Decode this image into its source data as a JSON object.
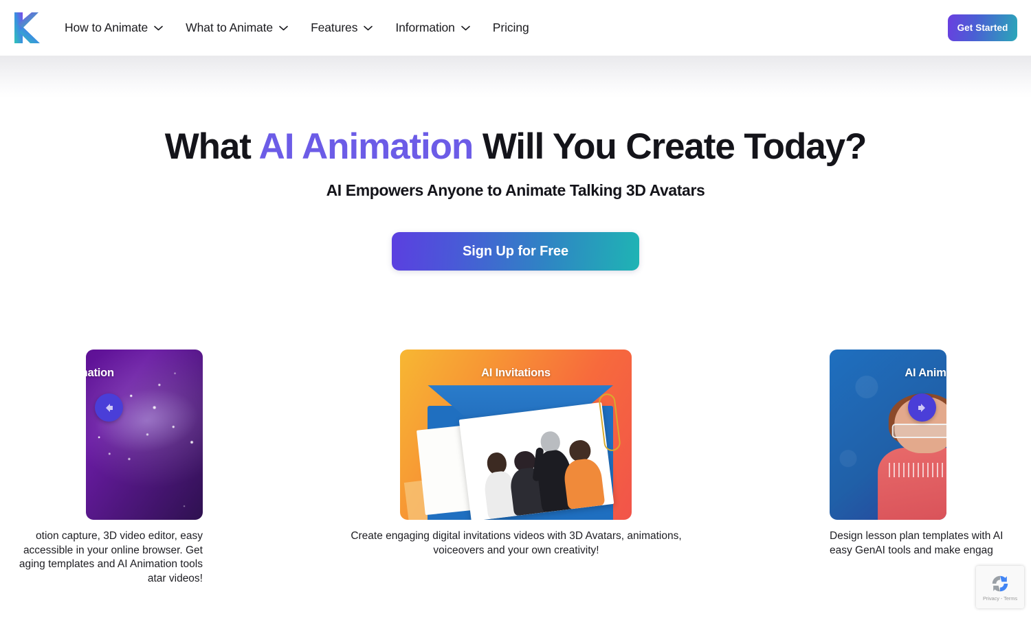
{
  "header": {
    "logo_alt": "Kinetix logo",
    "nav_items": [
      {
        "label": "How to Animate",
        "has_dropdown": true
      },
      {
        "label": "What to Animate",
        "has_dropdown": true
      },
      {
        "label": "Features",
        "has_dropdown": true
      },
      {
        "label": "Information",
        "has_dropdown": true
      },
      {
        "label": "Pricing",
        "has_dropdown": false
      }
    ],
    "get_started_label": "Get Started"
  },
  "hero": {
    "title_part1": "What ",
    "title_accent": "AI Animation",
    "title_part2": " Will You Create Today?",
    "subtitle": "AI Empowers Anyone to Animate Talking 3D Avatars",
    "cta_label": "Sign Up for Free"
  },
  "carousel": {
    "prev_icon": "arrow-left-icon",
    "next_icon": "arrow-right-icon",
    "slides": [
      {
        "id": "magic",
        "title": "Animation",
        "caption_lines": [
          "otion capture, 3D video editor, easy",
          " accessible in your online browser. Get",
          "aging templates and AI Animation tools",
          "atar videos!"
        ]
      },
      {
        "id": "invitations",
        "title": "AI Invitations",
        "caption_lines": [
          "Create engaging digital invitations videos with 3D Avatars, animations,",
          "voiceovers and your own creativity!"
        ]
      },
      {
        "id": "education",
        "title": "AI Animation fo",
        "caption_lines": [
          "Design lesson plan templates with AI",
          "easy GenAI tools and make engag"
        ]
      }
    ]
  },
  "recaptcha": {
    "text": "Privacy - Terms",
    "icon": "recaptcha-icon"
  },
  "colors": {
    "accent_purple": "#6c5ce7",
    "cta_gradient_start": "#5b3fe0",
    "cta_gradient_end": "#1fb4b4",
    "arrow_button": "#4a3ed8",
    "text_dark": "#14141a"
  }
}
